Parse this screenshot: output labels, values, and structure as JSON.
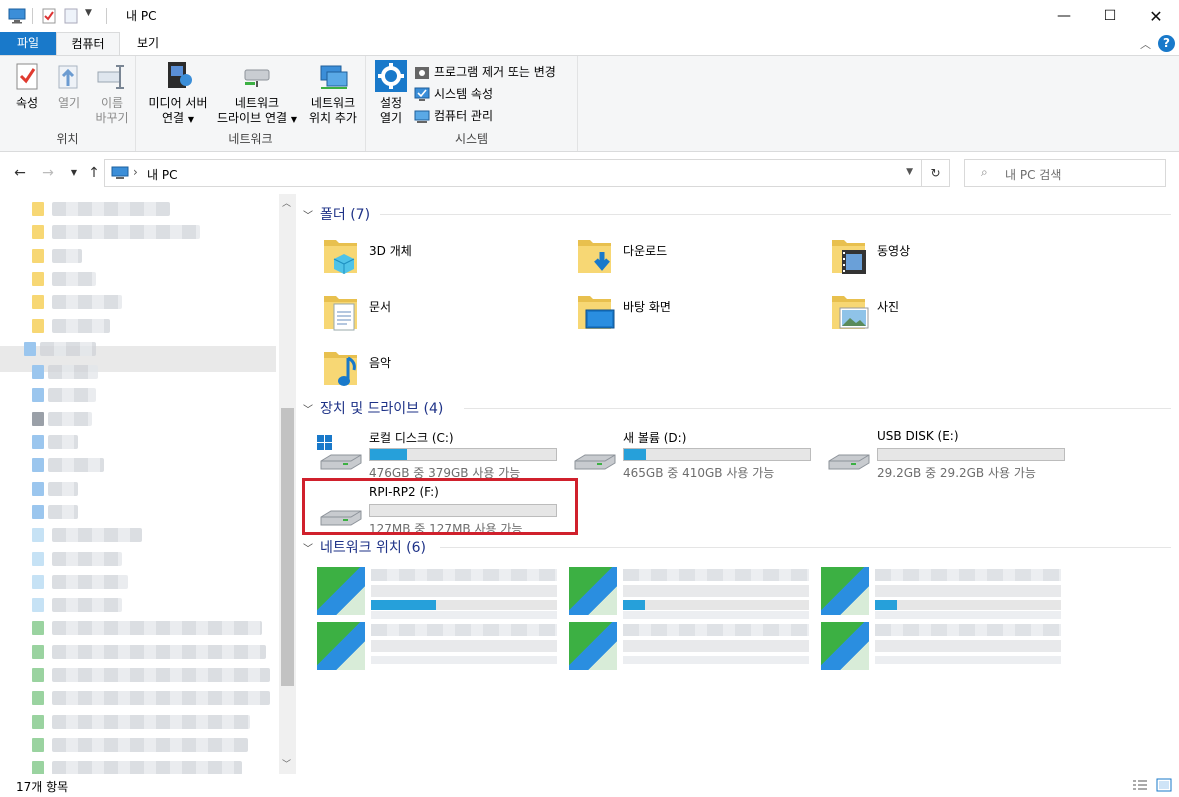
{
  "window": {
    "title": "내 PC"
  },
  "tabs": {
    "file": "파일",
    "computer": "컴퓨터",
    "view": "보기"
  },
  "ribbon": {
    "location": {
      "label": "위치",
      "properties": "속성",
      "open": "열기",
      "rename_1": "이름",
      "rename_2": "바꾸기"
    },
    "network": {
      "label": "네트워크",
      "media_1": "미디어 서버",
      "media_2": "연결",
      "map_1": "네트워크",
      "map_2": "드라이브 연결",
      "add_1": "네트워크",
      "add_2": "위치 추가"
    },
    "system": {
      "label": "시스템",
      "settings_1": "설정",
      "settings_2": "열기",
      "uninstall": "프로그램 제거 또는 변경",
      "sysprops": "시스템 속성",
      "manage": "컴퓨터 관리"
    }
  },
  "address": {
    "path": "내 PC",
    "search_placeholder": "내 PC 검색"
  },
  "sections": {
    "folders": "폴더 (7)",
    "drives": "장치 및 드라이브 (4)",
    "network": "네트워크 위치 (6)"
  },
  "folders": [
    {
      "name": "3D 개체",
      "icon": "3d-objects-folder-icon"
    },
    {
      "name": "다운로드",
      "icon": "downloads-folder-icon"
    },
    {
      "name": "동영상",
      "icon": "videos-folder-icon"
    },
    {
      "name": "문서",
      "icon": "documents-folder-icon"
    },
    {
      "name": "바탕 화면",
      "icon": "desktop-folder-icon"
    },
    {
      "name": "사진",
      "icon": "pictures-folder-icon"
    },
    {
      "name": "음악",
      "icon": "music-folder-icon"
    }
  ],
  "drives": [
    {
      "name": "로컬 디스크 (C:)",
      "info": "476GB 중 379GB 사용 가능",
      "used_fraction": 0.2
    },
    {
      "name": "새 볼륨 (D:)",
      "info": "465GB 중 410GB 사용 가능",
      "used_fraction": 0.12
    },
    {
      "name": "USB DISK (E:)",
      "info": "29.2GB 중 29.2GB 사용 가능",
      "used_fraction": 0.0
    },
    {
      "name": "RPI-RP2 (F:)",
      "info": "127MB 중 127MB 사용 가능",
      "used_fraction": 0.0
    }
  ],
  "status": {
    "count": "17개 항목"
  },
  "colors": {
    "accent": "#1979ca",
    "highlight": "#d0202c",
    "drive_fill": "#26a0da",
    "section_heading": "#1e3287"
  }
}
